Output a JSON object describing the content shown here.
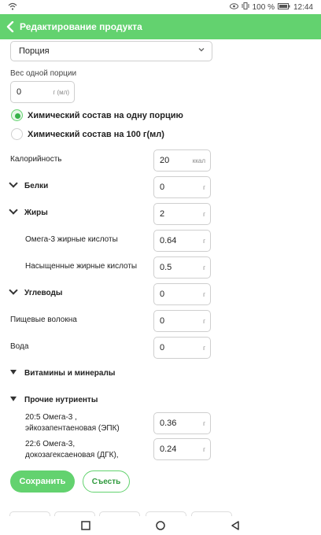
{
  "status": {
    "battery": "100 %",
    "time": "12:44"
  },
  "header": {
    "title": "Редактирование продукта"
  },
  "serving_select": {
    "value": "Порция"
  },
  "serving_weight": {
    "label": "Вес одной порции",
    "value": "0",
    "unit": "г (мл)"
  },
  "basis": {
    "per_serving": "Химический состав на одну порцию",
    "per_100g": "Химический состав на 100 г(мл)",
    "selected": "per_serving"
  },
  "rows": {
    "calories": {
      "label": "Калорийность",
      "value": "20",
      "unit": "ккал"
    },
    "proteins": {
      "label": "Белки",
      "value": "0",
      "unit": "г"
    },
    "fats": {
      "label": "Жиры",
      "value": "2",
      "unit": "г"
    },
    "omega3": {
      "label": "Омега-3 жирные кислоты",
      "value": "0.64",
      "unit": "г"
    },
    "saturated": {
      "label": "Насыщенные жирные кислоты",
      "value": "0.5",
      "unit": "г"
    },
    "carbs": {
      "label": "Углеводы",
      "value": "0",
      "unit": "г"
    },
    "fiber": {
      "label": "Пищевые волокна",
      "value": "0",
      "unit": "г"
    },
    "water": {
      "label": "Вода",
      "value": "0",
      "unit": "г"
    },
    "epa": {
      "label_line1": "20:5 Омега-3 ,",
      "label_line2": "эйкозапентаеновая (ЭПК)",
      "value": "0.36",
      "unit": "г"
    },
    "dha": {
      "label_line1": "22:6 Омега-3,",
      "label_line2": "докозагексаеновая (ДГК),",
      "value": "0.24",
      "unit": "г"
    }
  },
  "sections": {
    "vitamins": "Витамины и минералы",
    "other": "Прочие нутриенты"
  },
  "actions": {
    "save": "Сохранить",
    "eat": "Съесть"
  }
}
